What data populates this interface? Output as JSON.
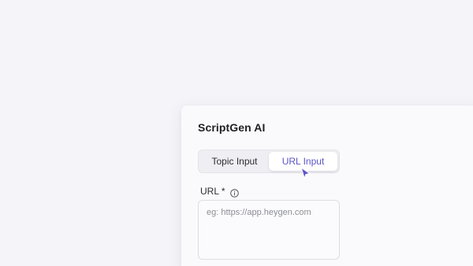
{
  "panel": {
    "title": "ScriptGen AI"
  },
  "tabs": [
    {
      "label": "Topic Input",
      "active": false
    },
    {
      "label": "URL Input",
      "active": true
    }
  ],
  "url_field": {
    "label": "URL *",
    "placeholder": "eg: https://app.heygen.com",
    "value": "",
    "info_icon": "info-circle-icon"
  },
  "colors": {
    "accent": "#5b55c9",
    "background": "#f5f5f9",
    "panel": "#fafafc"
  },
  "cursor_icon": "pointer-arrow-icon"
}
